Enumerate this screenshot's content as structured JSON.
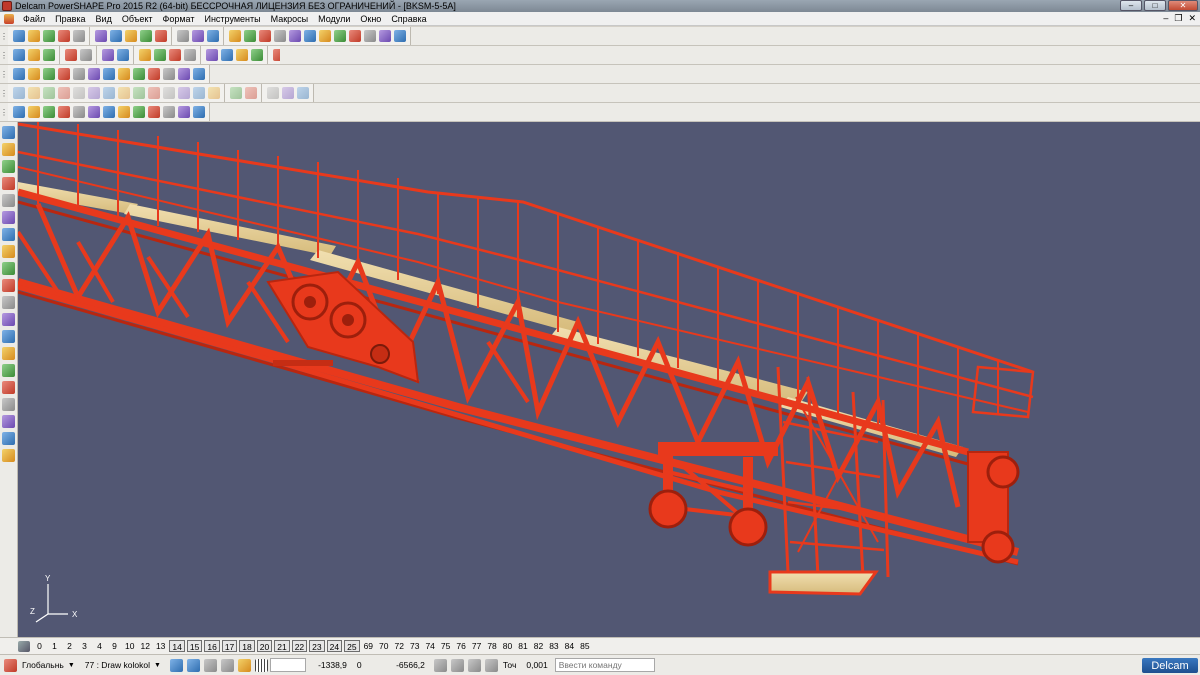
{
  "window": {
    "title": "Delcam PowerSHAPE Pro 2015 R2 (64-bit) БЕССРОЧНАЯ ЛИЦЕНЗИЯ БЕЗ ОГРАНИЧЕНИЙ - [BKSM-5-5A]",
    "minimize_glyph": "–",
    "maximize_glyph": "□",
    "close_glyph": "✕"
  },
  "menu": {
    "items": [
      "Файл",
      "Правка",
      "Вид",
      "Объект",
      "Формат",
      "Инструменты",
      "Макросы",
      "Модули",
      "Окно",
      "Справка"
    ],
    "mdi_minimize": "–",
    "mdi_restore": "❐",
    "mdi_close": "✕"
  },
  "levels": {
    "items": [
      {
        "label": "0",
        "boxed": false
      },
      {
        "label": "1",
        "boxed": false
      },
      {
        "label": "2",
        "boxed": false
      },
      {
        "label": "3",
        "boxed": false
      },
      {
        "label": "4",
        "boxed": false
      },
      {
        "label": "9",
        "boxed": false
      },
      {
        "label": "10",
        "boxed": false
      },
      {
        "label": "12",
        "boxed": false
      },
      {
        "label": "13",
        "boxed": false
      },
      {
        "label": "14",
        "boxed": true
      },
      {
        "label": "15",
        "boxed": true
      },
      {
        "label": "16",
        "boxed": true
      },
      {
        "label": "17",
        "boxed": true
      },
      {
        "label": "18",
        "boxed": true
      },
      {
        "label": "20",
        "boxed": true
      },
      {
        "label": "21",
        "boxed": true
      },
      {
        "label": "22",
        "boxed": true
      },
      {
        "label": "23",
        "boxed": true
      },
      {
        "label": "24",
        "boxed": true
      },
      {
        "label": "25",
        "boxed": true
      },
      {
        "label": "69",
        "boxed": false
      },
      {
        "label": "70",
        "boxed": false
      },
      {
        "label": "72",
        "boxed": false
      },
      {
        "label": "73",
        "boxed": false
      },
      {
        "label": "74",
        "boxed": false
      },
      {
        "label": "75",
        "boxed": false
      },
      {
        "label": "76",
        "boxed": false
      },
      {
        "label": "77",
        "boxed": false
      },
      {
        "label": "78",
        "boxed": false
      },
      {
        "label": "80",
        "boxed": false
      },
      {
        "label": "81",
        "boxed": false
      },
      {
        "label": "82",
        "boxed": false
      },
      {
        "label": "83",
        "boxed": false
      },
      {
        "label": "84",
        "boxed": false
      },
      {
        "label": "85",
        "boxed": false
      }
    ]
  },
  "status": {
    "workplane": "Глобальнь",
    "level_select": "77 : Draw kolokol",
    "x": "-1338,9",
    "y": "0",
    "z": "-6566,2",
    "tolerance_label": "Точ",
    "tolerance": "0,001",
    "command_placeholder": "Ввести команду",
    "brand": "Delcam"
  },
  "axes": {
    "x_label": "X",
    "y_label": "Y",
    "z_label": "Z"
  },
  "colors": {
    "viewport_bg": "#525773",
    "steel": "#e8391c",
    "steel_dark": "#b9260f",
    "deck": "#e6cf9a"
  },
  "toolbars": {
    "row1_groups": [
      {
        "icons": [
          "new-file-icon",
          "open-file-icon",
          "import-icon",
          "save-icon",
          "print-icon"
        ]
      },
      {
        "icons": [
          "cut-icon",
          "copy-icon",
          "paste-icon",
          "delete-icon",
          "erase-icon"
        ]
      },
      {
        "icons": [
          "undo-icon",
          "redo-icon",
          "text-icon"
        ]
      },
      {
        "icons": [
          "select-icon",
          "arrow-icon",
          "wireframe-icon",
          "line-icon",
          "circle-icon",
          "arc-icon",
          "curve-icon",
          "surface-icon",
          "solid-icon",
          "shade-icon",
          "render-icon",
          "measure-icon"
        ]
      }
    ],
    "row2_groups": [
      {
        "icons": [
          "view-front-icon",
          "view-back-icon",
          "view-left-icon"
        ]
      },
      {
        "icons": [
          "view-iso-icon",
          "view-top-icon"
        ]
      },
      {
        "icons": [
          "zoom-in-icon",
          "zoom-out-icon"
        ]
      },
      {
        "icons": [
          "zoom-window-icon",
          "zoom-fit-icon",
          "pan-icon",
          "rotate-icon"
        ]
      },
      {
        "icons": [
          "globe-icon",
          "shaded-icon",
          "wire-icon",
          "light-icon"
        ]
      },
      {
        "icons": [
          "settings-icon"
        ]
      }
    ],
    "row3_groups": [
      {
        "icons": [
          "plane-icon",
          "axis-icon",
          "grid-icon",
          "cube-icon",
          "cylinder-icon",
          "sphere-icon",
          "cone-icon",
          "torus-icon",
          "box-icon",
          "tube-icon",
          "extrude-icon",
          "revolve-icon",
          "fillet-icon"
        ]
      }
    ],
    "row4_groups": [
      {
        "icons": [
          "feature-icon",
          "pattern-icon",
          "shell-icon",
          "draft-icon",
          "chamfer-icon",
          "split-icon",
          "boolean-icon",
          "blend-icon",
          "offset-icon",
          "trim-icon",
          "extend-icon",
          "merge-icon",
          "thicken-icon",
          "mirror-icon"
        ]
      },
      {
        "icons": [
          "copy-solid-icon",
          "move-icon"
        ]
      },
      {
        "icons": [
          "history-icon",
          "tree-icon",
          "clip-icon"
        ]
      }
    ],
    "row5_groups": [
      {
        "icons": [
          "sheet-icon",
          "xform-icon",
          "assembly-icon",
          "part-icon",
          "component-icon",
          "weld-icon",
          "bolt-icon",
          "nut-icon",
          "pipe-icon",
          "beam-icon",
          "shape-icon",
          "link-icon",
          "box2-icon"
        ]
      }
    ],
    "left_icons": [
      "pointer-icon",
      "select-tool-icon",
      "wire-tool-icon",
      "layer-icon",
      "solid-tool-icon",
      "copy-tool-icon",
      "stack-icon",
      "history-tool-icon",
      "curve-tool-icon",
      "surface-tool-icon",
      "dim-icon",
      "text-tool-icon",
      "drawing-icon",
      "assembly-tool-icon",
      "render-tool-icon",
      "material-icon",
      "light-tool-icon",
      "camera-icon",
      "macro-icon",
      "help-icon"
    ]
  }
}
